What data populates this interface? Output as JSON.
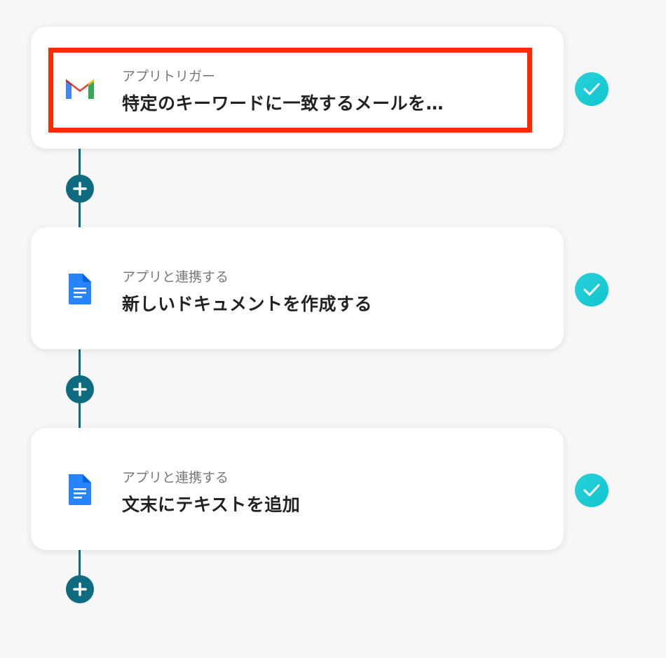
{
  "steps": [
    {
      "subtitle": "アプリトリガー",
      "title": "特定のキーワードに一致するメールを…",
      "icon": "gmail-icon",
      "status": "completed"
    },
    {
      "subtitle": "アプリと連携する",
      "title": "新しいドキュメントを作成する",
      "icon": "google-docs-icon",
      "status": "completed"
    },
    {
      "subtitle": "アプリと連携する",
      "title": "文末にテキストを追加",
      "icon": "google-docs-icon",
      "status": "completed"
    }
  ],
  "colors": {
    "connector": "#0f6b7f",
    "check": "#1ccbd4",
    "highlight": "#ff2a00"
  }
}
